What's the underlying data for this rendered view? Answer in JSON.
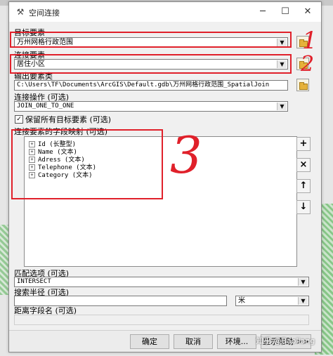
{
  "window": {
    "title": "空间连接",
    "min_icon": "minimize-icon",
    "max_icon": "maximize-icon",
    "close_icon": "close-icon"
  },
  "target_features": {
    "label": "目标要素",
    "value": "万州网格行政范围"
  },
  "join_features": {
    "label": "连接要素",
    "value": "居住小区"
  },
  "output_features": {
    "label": "输出要素类",
    "value": "C:\\Users\\TF\\Documents\\ArcGIS\\Default.gdb\\万州网格行政范围_SpatialJoin"
  },
  "join_operation": {
    "label": "连接操作 (可选)",
    "value": "JOIN_ONE_TO_ONE"
  },
  "keep_all": {
    "label": "保留所有目标要素 (可选)",
    "checked": true
  },
  "field_map": {
    "label": "连接要素的字段映射 (可选)",
    "fields": [
      "Id (长整型)",
      "Name (文本)",
      "Adress (文本)",
      "Telephone (文本)",
      "Category (文本)"
    ]
  },
  "side_buttons": [
    "+",
    "×",
    "↑",
    "↓"
  ],
  "match_option": {
    "label": "匹配选项 (可选)",
    "value": "INTERSECT"
  },
  "search_radius": {
    "label": "搜索半径 (可选)",
    "value": "",
    "unit": "米"
  },
  "distance_field": {
    "label": "距离字段名 (可选)",
    "value": ""
  },
  "buttons": {
    "ok": "确定",
    "cancel": "取消",
    "env": "环境...",
    "help": "显示帮助 >>"
  },
  "annotations": {
    "one": "1",
    "two": "2",
    "three": "3"
  },
  "watermark": "知乎 @Baoliang",
  "colors": {
    "annotation": "#e0202a",
    "window_bg": "#f0f0f0"
  }
}
